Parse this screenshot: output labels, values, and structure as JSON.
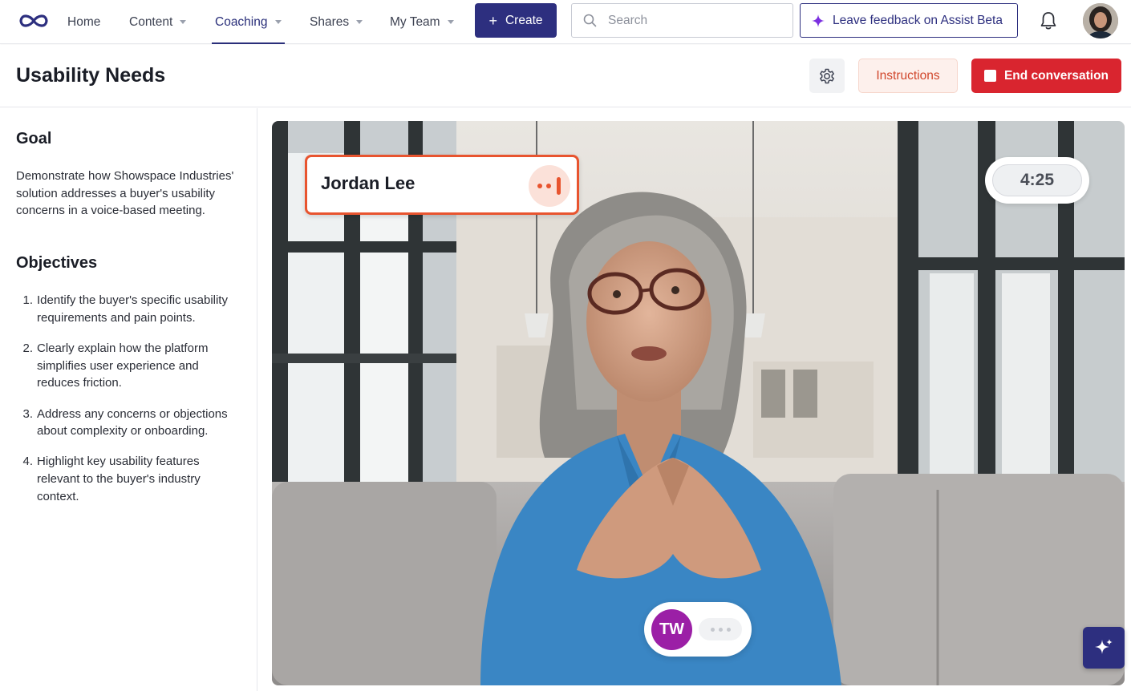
{
  "nav": {
    "home": "Home",
    "content": "Content",
    "coaching": "Coaching",
    "shares": "Shares",
    "my_team": "My Team",
    "create": "Create",
    "search_placeholder": "Search",
    "feedback": "Leave feedback on Assist Beta"
  },
  "header": {
    "title": "Usability Needs",
    "instructions": "Instructions",
    "end": "End conversation"
  },
  "panel": {
    "goal_title": "Goal",
    "goal_text": "Demonstrate how Showspace Industries' solution addresses a buyer's usability concerns in a voice-based meeting.",
    "objectives_title": "Objectives",
    "objectives": [
      {
        "num": "1.",
        "text": "Identify the buyer's specific usability requirements and pain points."
      },
      {
        "num": "2.",
        "text": "Clearly explain how the platform simplifies user experience and reduces friction."
      },
      {
        "num": "3.",
        "text": "Address any concerns or objections about complexity or onboarding."
      },
      {
        "num": "4.",
        "text": "Highlight key usability features relevant to the buyer's industry context."
      }
    ]
  },
  "stage": {
    "speaker_name": "Jordan Lee",
    "timer": "4:25",
    "user_initials": "TW"
  },
  "colors": {
    "brand": "#2d2f7f",
    "danger": "#d9252f",
    "speaker_accent": "#e8542f",
    "user_avatar": "#9b1fa6"
  },
  "icons": [
    "infinity-logo-icon",
    "caret-down-icon",
    "plus-icon",
    "search-icon",
    "sparkle-icon",
    "bell-icon",
    "gear-icon",
    "stop-icon",
    "audio-level-icon",
    "ellipsis-icon"
  ]
}
